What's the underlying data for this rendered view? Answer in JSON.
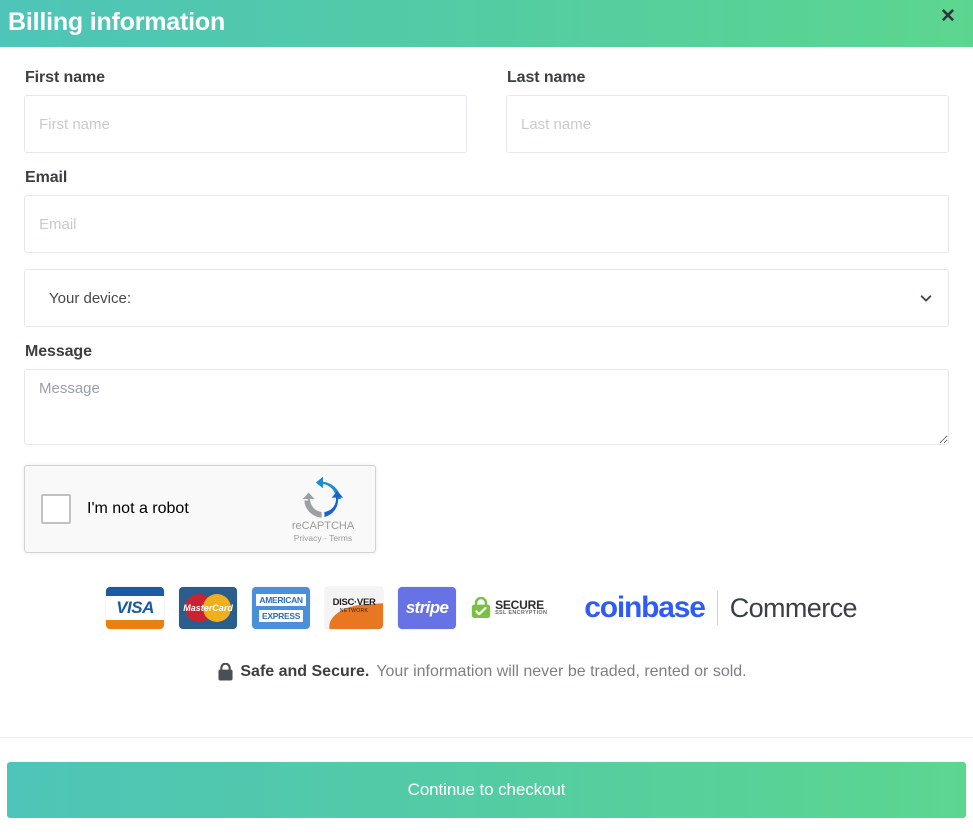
{
  "header": {
    "title": "Billing information",
    "close_label": "✕",
    "gradient_start": "#4ec5b8",
    "gradient_end": "#5cd68f"
  },
  "form": {
    "first_name": {
      "label": "First name",
      "placeholder": "First name",
      "value": ""
    },
    "last_name": {
      "label": "Last name",
      "placeholder": "Last name",
      "value": ""
    },
    "email": {
      "label": "Email",
      "placeholder": "Email",
      "value": ""
    },
    "device": {
      "selected": "Your device:",
      "options": [
        "Your device:"
      ]
    },
    "message": {
      "label": "Message",
      "placeholder": "Message",
      "value": ""
    }
  },
  "recaptcha": {
    "checkbox_label": "I'm not a robot",
    "brand": "reCAPTCHA",
    "links": "Privacy - Terms"
  },
  "payment_logos": [
    {
      "name": "visa",
      "text": "VISA"
    },
    {
      "name": "mastercard",
      "text": "MasterCard"
    },
    {
      "name": "american-express",
      "line1": "AMERICAN",
      "line2": "EXPRESS"
    },
    {
      "name": "discover",
      "text": "DISC·VER",
      "sub": "NETWORK"
    },
    {
      "name": "stripe",
      "text": "stripe"
    },
    {
      "name": "secure-ssl",
      "text": "SECURE",
      "sub": "SSL ENCRYPTION"
    }
  ],
  "coinbase": {
    "brand": "coinbase",
    "product": "Commerce",
    "brand_color": "#2f5cf6"
  },
  "safe_notice": {
    "bold": "Safe and Secure.",
    "rest": "Your information will never be traded, rented or sold."
  },
  "footer": {
    "continue_label": "Continue to checkout"
  }
}
